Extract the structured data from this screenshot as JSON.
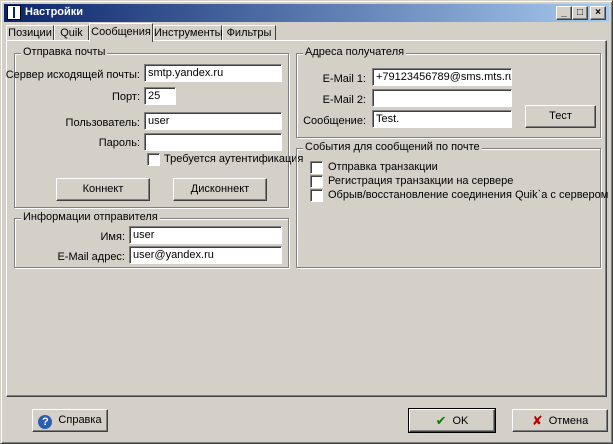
{
  "window": {
    "title": "Настройки",
    "minimize_glyph": "_",
    "maximize_glyph": "□",
    "close_glyph": "×"
  },
  "tabs": [
    {
      "label": "Позиции",
      "active": false
    },
    {
      "label": "Quik",
      "active": false
    },
    {
      "label": "Сообщения",
      "active": true
    },
    {
      "label": "Инструменты",
      "active": false
    },
    {
      "label": "Фильтры",
      "active": false
    }
  ],
  "mail_send": {
    "title": "Отправка почты",
    "smtp_label": "Сервер исходящей почты:",
    "smtp_value": "smtp.yandex.ru",
    "port_label": "Порт:",
    "port_value": "25",
    "user_label": "Пользователь:",
    "user_value": "user",
    "password_label": "Пароль:",
    "password_value": "",
    "auth_label": "Требуется аутентификация",
    "auth_checked": false,
    "connect_button": "Коннект",
    "disconnect_button": "Дисконнект"
  },
  "sender_info": {
    "title": "Информации отправителя",
    "name_label": "Имя:",
    "name_value": "user",
    "email_label": "E-Mail адрес:",
    "email_value": "user@yandex.ru"
  },
  "recipient": {
    "title": "Адреса получателя",
    "email1_label": "E-Mail 1:",
    "email1_value": "+79123456789@sms.mts.ru",
    "email2_label": "E-Mail 2:",
    "email2_value": "",
    "message_label": "Сообщение:",
    "message_value": "Test.",
    "test_button": "Тест"
  },
  "events": {
    "title": "События для сообщений по почте",
    "items": [
      {
        "label": "Отправка транзакции",
        "checked": false
      },
      {
        "label": "Регистрация транзакции на сервере",
        "checked": false
      },
      {
        "label": "Обрыв/восстановление соединения Quik`а с сервером",
        "checked": false
      }
    ]
  },
  "footer": {
    "help_button": "Справка",
    "ok_button": "OK",
    "cancel_button": "Отмена",
    "help_icon_glyph": "?",
    "ok_icon_glyph": "✔",
    "cancel_icon_glyph": "✘",
    "ok_icon_color": "#008000",
    "cancel_icon_color": "#c00000"
  }
}
